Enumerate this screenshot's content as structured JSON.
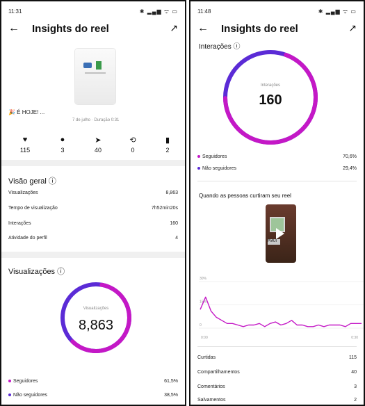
{
  "phone1": {
    "status": {
      "time": "11:31",
      "icons": "✱ ▂▄▆ ᯤ ▭"
    },
    "header": {
      "back_icon": "arrow-left-icon",
      "title": "Insights do reel",
      "trend_icon": "trend-icon"
    },
    "caption": "🎉 É HOJE! ...",
    "date_duration": "7 de julho · Duração 0:31",
    "stats": [
      {
        "icon": "heart-icon",
        "glyph": "♥",
        "value": "115"
      },
      {
        "icon": "comment-icon",
        "glyph": "●",
        "value": "3"
      },
      {
        "icon": "send-icon",
        "glyph": "➤",
        "value": "40"
      },
      {
        "icon": "repost-icon",
        "glyph": "⟲",
        "value": "0"
      },
      {
        "icon": "bookmark-icon",
        "glyph": "▮",
        "value": "2"
      }
    ],
    "overview": {
      "title": "Visão geral",
      "info_icon": "ⓘ",
      "rows": [
        {
          "label": "Visualizações",
          "value": "8,863"
        },
        {
          "label": "Tempo de visualização",
          "value": "7h52min20s"
        },
        {
          "label": "Interações",
          "value": "160"
        },
        {
          "label": "Atividade do perfil",
          "value": "4"
        }
      ]
    },
    "views": {
      "title": "Visualizações",
      "info_icon": "ⓘ",
      "ring_label": "Visualizações",
      "ring_value": "8,863",
      "followers_pct": 61.5,
      "legend": [
        {
          "label": "Seguidores",
          "value": "61,5%",
          "color": "#c418c6"
        },
        {
          "label": "Não seguidores",
          "value": "38,5%",
          "color": "#5b2bd6"
        }
      ]
    }
  },
  "phone2": {
    "status": {
      "time": "11:48",
      "icons": "✱ ▂▄▆ ᯤ ▭"
    },
    "header": {
      "back_icon": "arrow-left-icon",
      "title": "Insights do reel",
      "trend_icon": "trend-icon"
    },
    "interactions": {
      "title": "Interações",
      "info_icon": "ⓘ",
      "ring_label": "Interações",
      "ring_value": "160",
      "followers_pct": 70.6,
      "legend": [
        {
          "label": "Seguidores",
          "value": "70,6%",
          "color": "#c418c6"
        },
        {
          "label": "Não seguidores",
          "value": "29,4%",
          "color": "#5b2bd6"
        }
      ]
    },
    "likes_when": {
      "title": "Quando as pessoas curtiram seu reel",
      "thumb_sign": "PIAUÍ"
    },
    "rows": [
      {
        "label": "Curtidas",
        "value": "115"
      },
      {
        "label": "Compartilhamentos",
        "value": "40"
      },
      {
        "label": "Comentários",
        "value": "3"
      },
      {
        "label": "Salvamentos",
        "value": "2"
      }
    ]
  },
  "chart_data": {
    "type": "line",
    "y_ticks": [
      "30%",
      "15%",
      "0"
    ],
    "x_ticks": [
      "0:00",
      "0:30"
    ],
    "ylim": [
      0,
      30
    ],
    "xlim": [
      0,
      30
    ],
    "color": "#c418c6",
    "x": [
      0,
      1,
      2,
      3,
      4,
      5,
      6,
      7,
      8,
      9,
      10,
      11,
      12,
      13,
      14,
      15,
      16,
      17,
      18,
      19,
      20,
      21,
      22,
      23,
      24,
      25,
      26,
      27,
      28,
      29,
      30
    ],
    "y": [
      12,
      20,
      11,
      7,
      5,
      3,
      3,
      2,
      1,
      2,
      2,
      3,
      1,
      3,
      4,
      2,
      3,
      5,
      2,
      2,
      1,
      1,
      2,
      1,
      2,
      2,
      2,
      1,
      3,
      3,
      3
    ]
  }
}
